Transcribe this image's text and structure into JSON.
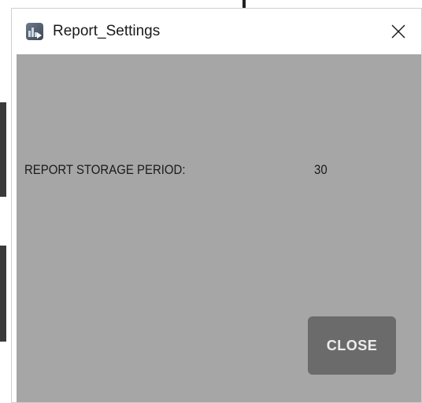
{
  "window": {
    "title": "Report_Settings",
    "app_icon": "report-app-icon",
    "close_icon": "close-icon"
  },
  "settings": {
    "storage_period_label": "REPORT STORAGE PERIOD:",
    "storage_period_value": "30"
  },
  "actions": {
    "close_label": "CLOSE"
  },
  "colors": {
    "content_background": "#a6a6a6",
    "button_background": "#6b6b6b",
    "button_text": "#ededed",
    "titlebar_background": "#ffffff"
  }
}
